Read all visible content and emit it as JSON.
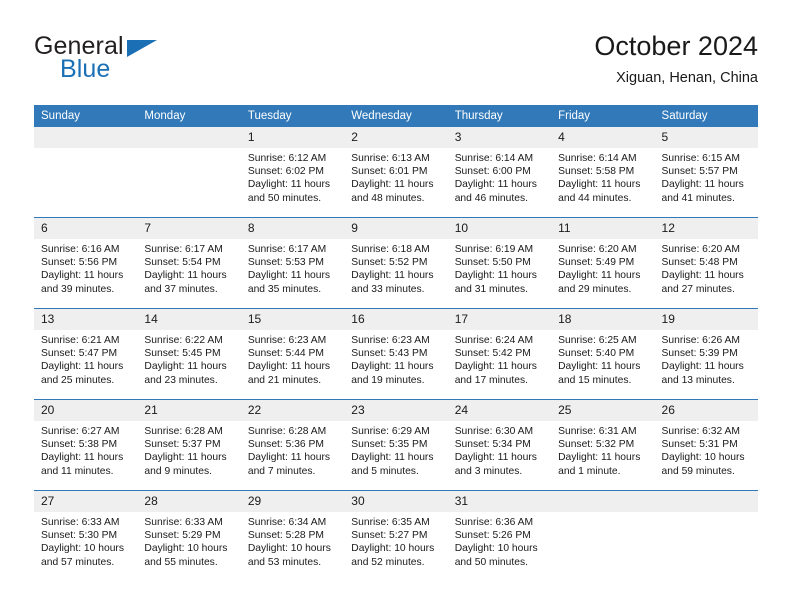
{
  "brand": {
    "name_top": "General",
    "name_bottom": "Blue",
    "color_dark": "#231f20",
    "color_blue": "#1a6fb5"
  },
  "header": {
    "title": "October 2024",
    "location": "Xiguan, Henan, China"
  },
  "theme": {
    "header_bg": "#3179b9",
    "header_text": "#ffffff",
    "daynum_bg": "#efefef",
    "grid_line": "#3179b9"
  },
  "weekday_headers": [
    "Sunday",
    "Monday",
    "Tuesday",
    "Wednesday",
    "Thursday",
    "Friday",
    "Saturday"
  ],
  "weeks": [
    [
      {
        "day": "",
        "sunrise": "",
        "sunset": "",
        "daylight": "",
        "blank": true
      },
      {
        "day": "",
        "sunrise": "",
        "sunset": "",
        "daylight": "",
        "blank": true
      },
      {
        "day": "1",
        "sunrise": "Sunrise: 6:12 AM",
        "sunset": "Sunset: 6:02 PM",
        "daylight": "Daylight: 11 hours and 50 minutes."
      },
      {
        "day": "2",
        "sunrise": "Sunrise: 6:13 AM",
        "sunset": "Sunset: 6:01 PM",
        "daylight": "Daylight: 11 hours and 48 minutes."
      },
      {
        "day": "3",
        "sunrise": "Sunrise: 6:14 AM",
        "sunset": "Sunset: 6:00 PM",
        "daylight": "Daylight: 11 hours and 46 minutes."
      },
      {
        "day": "4",
        "sunrise": "Sunrise: 6:14 AM",
        "sunset": "Sunset: 5:58 PM",
        "daylight": "Daylight: 11 hours and 44 minutes."
      },
      {
        "day": "5",
        "sunrise": "Sunrise: 6:15 AM",
        "sunset": "Sunset: 5:57 PM",
        "daylight": "Daylight: 11 hours and 41 minutes."
      }
    ],
    [
      {
        "day": "6",
        "sunrise": "Sunrise: 6:16 AM",
        "sunset": "Sunset: 5:56 PM",
        "daylight": "Daylight: 11 hours and 39 minutes."
      },
      {
        "day": "7",
        "sunrise": "Sunrise: 6:17 AM",
        "sunset": "Sunset: 5:54 PM",
        "daylight": "Daylight: 11 hours and 37 minutes."
      },
      {
        "day": "8",
        "sunrise": "Sunrise: 6:17 AM",
        "sunset": "Sunset: 5:53 PM",
        "daylight": "Daylight: 11 hours and 35 minutes."
      },
      {
        "day": "9",
        "sunrise": "Sunrise: 6:18 AM",
        "sunset": "Sunset: 5:52 PM",
        "daylight": "Daylight: 11 hours and 33 minutes."
      },
      {
        "day": "10",
        "sunrise": "Sunrise: 6:19 AM",
        "sunset": "Sunset: 5:50 PM",
        "daylight": "Daylight: 11 hours and 31 minutes."
      },
      {
        "day": "11",
        "sunrise": "Sunrise: 6:20 AM",
        "sunset": "Sunset: 5:49 PM",
        "daylight": "Daylight: 11 hours and 29 minutes."
      },
      {
        "day": "12",
        "sunrise": "Sunrise: 6:20 AM",
        "sunset": "Sunset: 5:48 PM",
        "daylight": "Daylight: 11 hours and 27 minutes."
      }
    ],
    [
      {
        "day": "13",
        "sunrise": "Sunrise: 6:21 AM",
        "sunset": "Sunset: 5:47 PM",
        "daylight": "Daylight: 11 hours and 25 minutes."
      },
      {
        "day": "14",
        "sunrise": "Sunrise: 6:22 AM",
        "sunset": "Sunset: 5:45 PM",
        "daylight": "Daylight: 11 hours and 23 minutes."
      },
      {
        "day": "15",
        "sunrise": "Sunrise: 6:23 AM",
        "sunset": "Sunset: 5:44 PM",
        "daylight": "Daylight: 11 hours and 21 minutes."
      },
      {
        "day": "16",
        "sunrise": "Sunrise: 6:23 AM",
        "sunset": "Sunset: 5:43 PM",
        "daylight": "Daylight: 11 hours and 19 minutes."
      },
      {
        "day": "17",
        "sunrise": "Sunrise: 6:24 AM",
        "sunset": "Sunset: 5:42 PM",
        "daylight": "Daylight: 11 hours and 17 minutes."
      },
      {
        "day": "18",
        "sunrise": "Sunrise: 6:25 AM",
        "sunset": "Sunset: 5:40 PM",
        "daylight": "Daylight: 11 hours and 15 minutes."
      },
      {
        "day": "19",
        "sunrise": "Sunrise: 6:26 AM",
        "sunset": "Sunset: 5:39 PM",
        "daylight": "Daylight: 11 hours and 13 minutes."
      }
    ],
    [
      {
        "day": "20",
        "sunrise": "Sunrise: 6:27 AM",
        "sunset": "Sunset: 5:38 PM",
        "daylight": "Daylight: 11 hours and 11 minutes."
      },
      {
        "day": "21",
        "sunrise": "Sunrise: 6:28 AM",
        "sunset": "Sunset: 5:37 PM",
        "daylight": "Daylight: 11 hours and 9 minutes."
      },
      {
        "day": "22",
        "sunrise": "Sunrise: 6:28 AM",
        "sunset": "Sunset: 5:36 PM",
        "daylight": "Daylight: 11 hours and 7 minutes."
      },
      {
        "day": "23",
        "sunrise": "Sunrise: 6:29 AM",
        "sunset": "Sunset: 5:35 PM",
        "daylight": "Daylight: 11 hours and 5 minutes."
      },
      {
        "day": "24",
        "sunrise": "Sunrise: 6:30 AM",
        "sunset": "Sunset: 5:34 PM",
        "daylight": "Daylight: 11 hours and 3 minutes."
      },
      {
        "day": "25",
        "sunrise": "Sunrise: 6:31 AM",
        "sunset": "Sunset: 5:32 PM",
        "daylight": "Daylight: 11 hours and 1 minute."
      },
      {
        "day": "26",
        "sunrise": "Sunrise: 6:32 AM",
        "sunset": "Sunset: 5:31 PM",
        "daylight": "Daylight: 10 hours and 59 minutes."
      }
    ],
    [
      {
        "day": "27",
        "sunrise": "Sunrise: 6:33 AM",
        "sunset": "Sunset: 5:30 PM",
        "daylight": "Daylight: 10 hours and 57 minutes."
      },
      {
        "day": "28",
        "sunrise": "Sunrise: 6:33 AM",
        "sunset": "Sunset: 5:29 PM",
        "daylight": "Daylight: 10 hours and 55 minutes."
      },
      {
        "day": "29",
        "sunrise": "Sunrise: 6:34 AM",
        "sunset": "Sunset: 5:28 PM",
        "daylight": "Daylight: 10 hours and 53 minutes."
      },
      {
        "day": "30",
        "sunrise": "Sunrise: 6:35 AM",
        "sunset": "Sunset: 5:27 PM",
        "daylight": "Daylight: 10 hours and 52 minutes."
      },
      {
        "day": "31",
        "sunrise": "Sunrise: 6:36 AM",
        "sunset": "Sunset: 5:26 PM",
        "daylight": "Daylight: 10 hours and 50 minutes."
      },
      {
        "day": "",
        "sunrise": "",
        "sunset": "",
        "daylight": "",
        "blank": true
      },
      {
        "day": "",
        "sunrise": "",
        "sunset": "",
        "daylight": "",
        "blank": true
      }
    ]
  ]
}
